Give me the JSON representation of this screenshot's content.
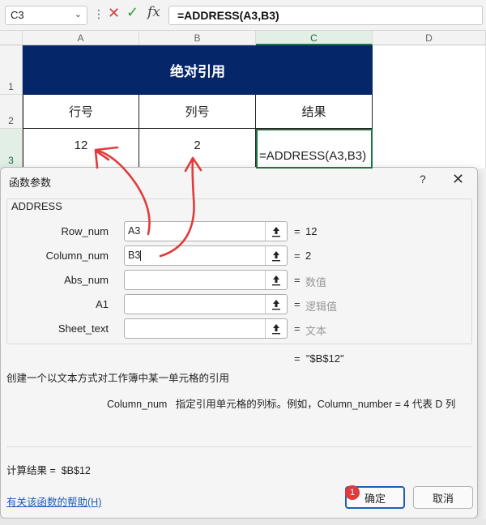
{
  "formula_bar": {
    "name_box": "C3",
    "cancel_icon": "close-icon",
    "enter_icon": "check-icon",
    "fx_label": "fx",
    "formula": "=ADDRESS(A3,B3)"
  },
  "sheet": {
    "columns": [
      "A",
      "B",
      "C",
      "D"
    ],
    "rows": [
      "1",
      "2",
      "3"
    ],
    "title": "绝对引用",
    "headers": [
      "行号",
      "列号",
      "结果"
    ],
    "row3": {
      "a": "12",
      "b": "2",
      "c": "=ADDRESS(A3,B3)"
    },
    "accent": "#06266a"
  },
  "dialog": {
    "title": "函数参数",
    "help_glyph": "?",
    "function_name": "ADDRESS",
    "args": [
      {
        "label": "Row_num",
        "value": "A3",
        "result": "12"
      },
      {
        "label": "Column_num",
        "value": "B3",
        "result": "2"
      },
      {
        "label": "Abs_num",
        "value": "",
        "result": "数值"
      },
      {
        "label": "A1",
        "value": "",
        "result": "逻辑值"
      },
      {
        "label": "Sheet_text",
        "value": "",
        "result": "文本"
      }
    ],
    "eq": "=",
    "formula_result": "\"$B$12\"",
    "description": "创建一个以文本方式对工作簿中某一单元格的引用",
    "param_name": "Column_num",
    "param_description": "指定引用单元格的列标。例如，Column_number = 4 代表 D 列",
    "calc_label": "计算结果 =",
    "calc_value": "$B$12",
    "help_link": "有关该函数的帮助(H)",
    "ok_label": "确定",
    "cancel_label": "取消",
    "badge": "1"
  }
}
